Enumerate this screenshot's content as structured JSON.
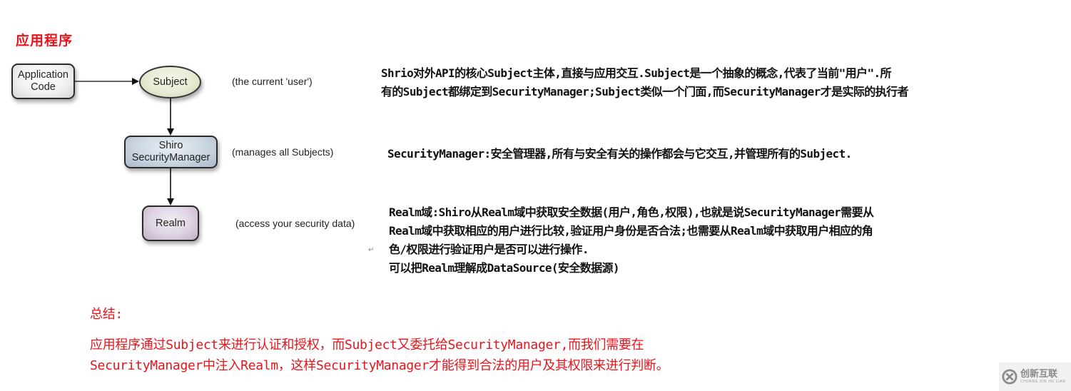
{
  "page_title": "应用程序",
  "diagram": {
    "nodes": {
      "application_code": "Application\nCode",
      "subject": "Subject",
      "security_manager": "Shiro\nSecurityManager",
      "realm": "Realm"
    },
    "notes": {
      "subject": "(the current 'user')",
      "security_manager": "(manages all Subjects)",
      "realm": "(access your security data)"
    },
    "colors": {
      "application_code_fill": "#f2f2f2",
      "subject_fill": "#e7ead3",
      "security_manager_fill": "#ccd6e2",
      "realm_fill": "#ddd2e2"
    }
  },
  "descriptions": {
    "subject": [
      "Shrio对外API的核心Subject主体,直接与应用交互.Subject是一个抽象的概念,代表了当前\"用户\".所",
      "有的Subject都绑定到SecurityManager;Subject类似一个门面,而SecurityManager才是实际的执行者"
    ],
    "security_manager": [
      "SecurityManager:安全管理器,所有与安全有关的操作都会与它交互,并管理所有的Subject."
    ],
    "realm": [
      "Realm域:Shiro从Realm域中获取安全数据(用户,角色,权限),也就是说SecurityManager需要从",
      "Realm域中获取相应的用户进行比较,验证用户身份是否合法;也需要从Realm域中获取用户相应的角",
      "色/权限进行验证用户是否可以进行操作.",
      "可以把Realm理解成DataSource(安全数据源)"
    ]
  },
  "summary": {
    "heading": "总结:",
    "lines": [
      "应用程序通过Subject来进行认证和授权，而Subject又委托给SecurityManager,而我们需要在",
      "SecurityManager中注入Realm，这样SecurityManager才能得到合法的用户及其权限来进行判断。"
    ]
  },
  "paragraph_mark": "↵",
  "watermark": {
    "name_cn": "创新互联",
    "name_en": "CHUANG XIN HU LIAN"
  },
  "accent_color": "#e8141b"
}
